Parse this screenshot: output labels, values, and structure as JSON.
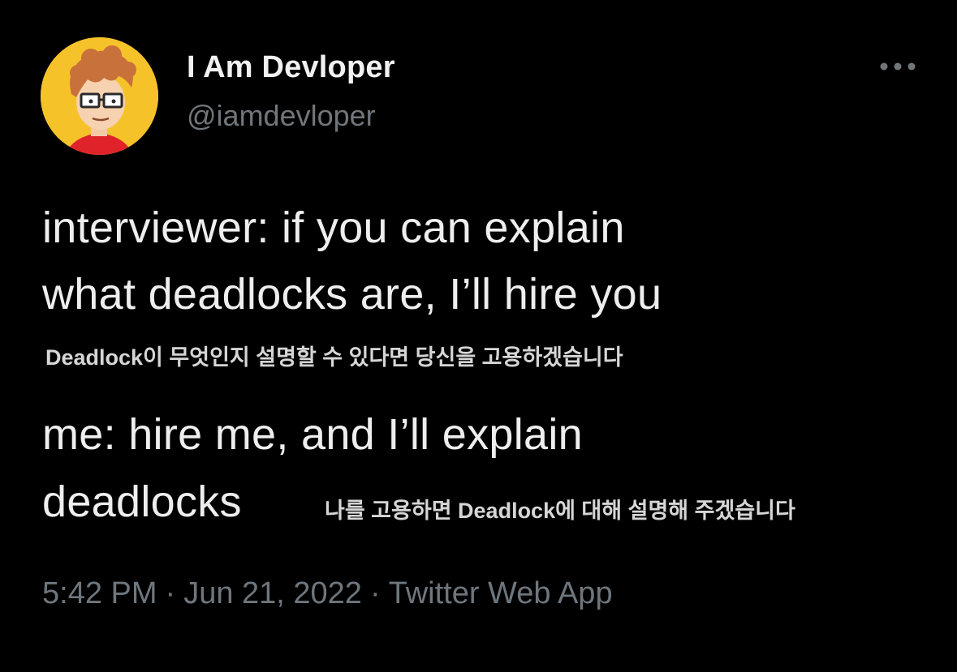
{
  "author": {
    "display_name": "I Am Devloper",
    "handle": "@iamdevloper",
    "avatar_icon": "cartoon-developer-avatar",
    "avatar_bg": "#f6c22a"
  },
  "menu": {
    "more_icon": "ellipsis-horizontal-icon"
  },
  "tweet": {
    "lines": [
      "interviewer: if you can explain",
      "what deadlocks are, I’ll hire you",
      "me: hire me, and I’ll explain",
      "deadlocks"
    ],
    "captions": [
      "Deadlock이 무엇인지 설명할 수 있다면 당신을 고용하겠습니다",
      "나를 고용하면 Deadlock에 대해 설명해 주겠습니다"
    ]
  },
  "meta": {
    "time": "5:42 PM",
    "separator": "·",
    "date": "Jun 21, 2022",
    "source": "Twitter Web App"
  },
  "colors": {
    "background": "#000000",
    "primary_text": "#eeeeee",
    "secondary_text": "#71767b"
  }
}
